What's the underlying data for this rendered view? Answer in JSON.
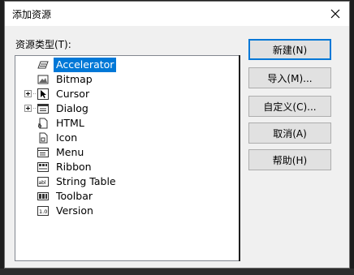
{
  "dialog": {
    "title": "添加资源",
    "close_label": "×"
  },
  "resource_type": {
    "label": "资源类型(T):"
  },
  "tree": {
    "items": [
      {
        "label": "Accelerator",
        "icon": "accelerator-icon",
        "expandable": false,
        "selected": true
      },
      {
        "label": "Bitmap",
        "icon": "bitmap-icon",
        "expandable": false,
        "selected": false
      },
      {
        "label": "Cursor",
        "icon": "cursor-icon",
        "expandable": true,
        "selected": false
      },
      {
        "label": "Dialog",
        "icon": "dialog-icon",
        "expandable": true,
        "selected": false
      },
      {
        "label": "HTML",
        "icon": "html-icon",
        "expandable": false,
        "selected": false
      },
      {
        "label": "Icon",
        "icon": "icon-resource-icon",
        "expandable": false,
        "selected": false
      },
      {
        "label": "Menu",
        "icon": "menu-icon",
        "expandable": false,
        "selected": false
      },
      {
        "label": "Ribbon",
        "icon": "ribbon-icon",
        "expandable": false,
        "selected": false
      },
      {
        "label": "String Table",
        "icon": "string-table-icon",
        "expandable": false,
        "selected": false
      },
      {
        "label": "Toolbar",
        "icon": "toolbar-icon",
        "expandable": false,
        "selected": false
      },
      {
        "label": "Version",
        "icon": "version-icon",
        "expandable": false,
        "selected": false
      }
    ]
  },
  "buttons": {
    "new": "新建(N)",
    "import": "导入(M)...",
    "custom": "自定义(C)...",
    "cancel": "取消(A)",
    "help": "帮助(H)"
  },
  "colors": {
    "selection": "#0078d7",
    "dialog_bg": "#f0f0f0",
    "button_bg": "#e1e1e1"
  }
}
